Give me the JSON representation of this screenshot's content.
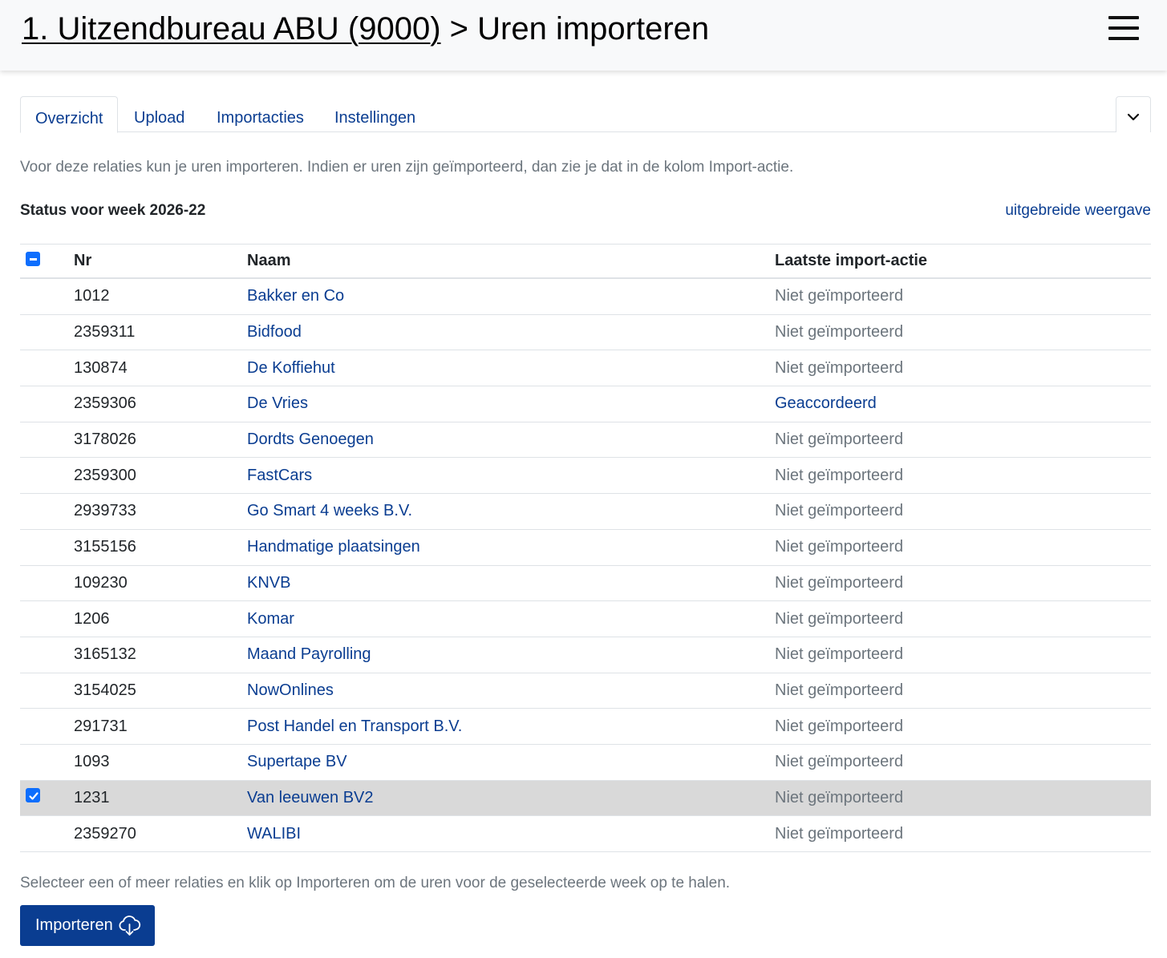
{
  "header": {
    "org_link": "1. Uitzendbureau ABU (9000)",
    "separator": " > ",
    "page_title": "Uren importeren"
  },
  "tabs": [
    {
      "label": "Overzicht",
      "active": true
    },
    {
      "label": "Upload",
      "active": false
    },
    {
      "label": "Importacties",
      "active": false
    },
    {
      "label": "Instellingen",
      "active": false
    }
  ],
  "intro_text": "Voor deze relaties kun je uren importeren. Indien er uren zijn geïmporteerd, dan zie je dat in de kolom Import-actie.",
  "status_title": "Status voor week 2026-22",
  "extended_view_link": "uitgebreide weergave",
  "table": {
    "columns": {
      "nr": "Nr",
      "name": "Naam",
      "action": "Laatste import-actie"
    },
    "rows": [
      {
        "nr": "1012",
        "name": "Bakker en Co",
        "action": "Niet geïmporteerd",
        "selected": false
      },
      {
        "nr": "2359311",
        "name": "Bidfood",
        "action": "Niet geïmporteerd",
        "selected": false
      },
      {
        "nr": "130874",
        "name": "De Koffiehut",
        "action": "Niet geïmporteerd",
        "selected": false
      },
      {
        "nr": "2359306",
        "name": "De Vries",
        "action": "Geaccordeerd",
        "selected": false
      },
      {
        "nr": "3178026",
        "name": "Dordts Genoegen",
        "action": "Niet geïmporteerd",
        "selected": false
      },
      {
        "nr": "2359300",
        "name": "FastCars",
        "action": "Niet geïmporteerd",
        "selected": false
      },
      {
        "nr": "2939733",
        "name": "Go Smart 4 weeks B.V.",
        "action": "Niet geïmporteerd",
        "selected": false
      },
      {
        "nr": "3155156",
        "name": "Handmatige plaatsingen",
        "action": "Niet geïmporteerd",
        "selected": false
      },
      {
        "nr": "109230",
        "name": "KNVB",
        "action": "Niet geïmporteerd",
        "selected": false
      },
      {
        "nr": "1206",
        "name": "Komar",
        "action": "Niet geïmporteerd",
        "selected": false
      },
      {
        "nr": "3165132",
        "name": "Maand Payrolling",
        "action": "Niet geïmporteerd",
        "selected": false
      },
      {
        "nr": "3154025",
        "name": "NowOnlines",
        "action": "Niet geïmporteerd",
        "selected": false
      },
      {
        "nr": "291731",
        "name": "Post Handel en Transport B.V.",
        "action": "Niet geïmporteerd",
        "selected": false
      },
      {
        "nr": "1093",
        "name": "Supertape BV",
        "action": "Niet geïmporteerd",
        "selected": false
      },
      {
        "nr": "1231",
        "name": "Van leeuwen BV2",
        "action": "Niet geïmporteerd",
        "selected": true
      },
      {
        "nr": "2359270",
        "name": "WALIBI",
        "action": "Niet geïmporteerd",
        "selected": false
      }
    ]
  },
  "footer_text": "Selecteer een of meer relaties en klik op Importeren om de uren voor de geselecteerde week op te halen.",
  "import_button": {
    "label": "Importeren",
    "icon": "cloud-download-icon"
  },
  "colors": {
    "accent": "#0a3d91",
    "checkbox": "#0d6efd",
    "selected_row": "#d9d9d9",
    "muted_text": "#6c757d"
  }
}
